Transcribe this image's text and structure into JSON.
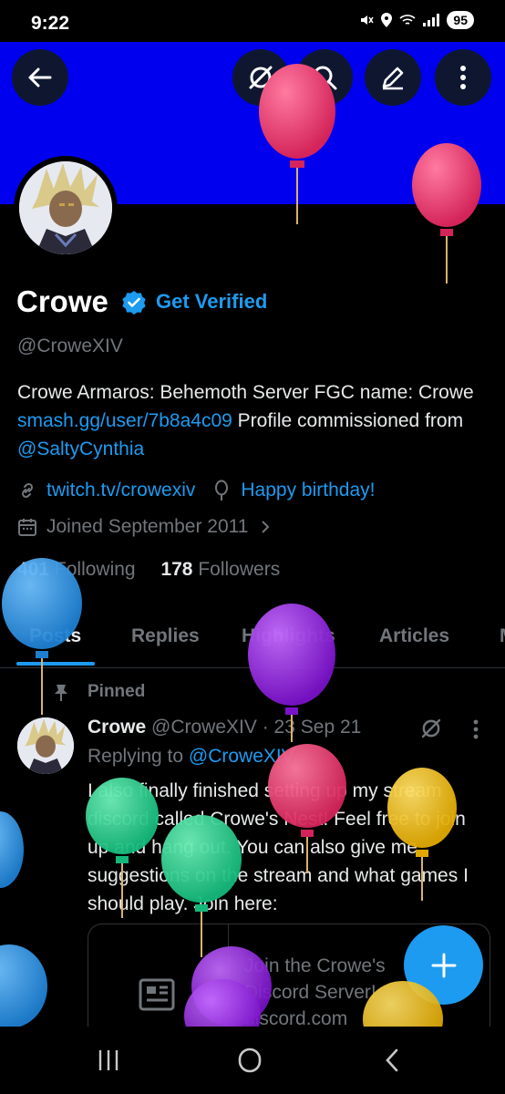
{
  "status_bar": {
    "time": "9:22",
    "battery": "95"
  },
  "profile": {
    "name": "Crowe",
    "get_verified": "Get Verified",
    "handle": "@CroweXIV",
    "bio": {
      "part1": "Crowe Armaros: Behemoth Server  FGC name: Crowe ",
      "link1": "smash.gg/user/7b8a4c09",
      "part2": " Profile commissioned from ",
      "link2": "@SaltyCynthia"
    },
    "website": "twitch.tv/crowexiv",
    "birthday": "Happy birthday!",
    "joined": "Joined September 2011",
    "following_count": "401",
    "following_label": "Following",
    "followers_count": "178",
    "followers_label": "Followers"
  },
  "tabs": [
    "Posts",
    "Replies",
    "Highlights",
    "Articles",
    "M"
  ],
  "post": {
    "pinned_label": "Pinned",
    "author": "Crowe",
    "handle": "@CroweXIV",
    "date": "· 23 Sep 21",
    "replying_label": "Replying to ",
    "replying_handle": "@CroweXIV",
    "text": "I also finally finished setting up my stream discord called Crowe's Nest! Feel free to join up and hang out. You can also give me suggestions on the stream and what games I should play. Join here:",
    "card_title": "Join the Crowe's Discord Server!",
    "card_domain": "discord.com"
  },
  "icons": {
    "back": "back-arrow-icon",
    "grok": "grok-icon",
    "search": "search-icon",
    "edit": "edit-icon",
    "more": "more-vertical-icon"
  },
  "colors": {
    "banner": "#0000ee",
    "accent": "#1d9bf0",
    "background": "#000000"
  }
}
